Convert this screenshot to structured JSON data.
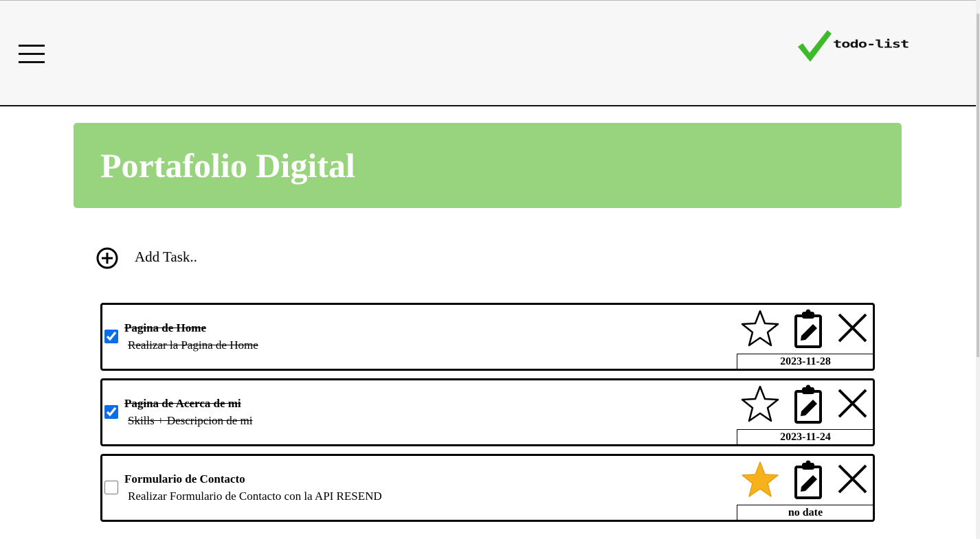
{
  "header": {
    "logo_text": "todo-list",
    "menu_icon": "hamburger-icon",
    "logo_icon": "checkmark-icon",
    "logo_color": "#3fba2a",
    "background": "#f6f7f6"
  },
  "project": {
    "title": "Portafolio Digital",
    "banner_color": "#97d47d"
  },
  "add_task": {
    "label": "Add Task..",
    "icon": "plus-circle-icon"
  },
  "tasks": [
    {
      "title": "Pagina de Home",
      "description": "Realizar la Pagina de Home",
      "completed": true,
      "starred": false,
      "date": "2023-11-28"
    },
    {
      "title": "Pagina de Acerca de mi",
      "description": "Skills + Descripcion de mi",
      "completed": true,
      "starred": false,
      "date": "2023-11-24"
    },
    {
      "title": "Formulario de Contacto",
      "description": "Realizar Formulario de Contacto con la API RESEND",
      "completed": false,
      "starred": true,
      "date": "no date"
    }
  ],
  "task_actions": {
    "star_icon": "star-icon",
    "edit_icon": "clipboard-edit-icon",
    "delete_icon": "close-icon",
    "star_active_color": "#f7b21b"
  }
}
